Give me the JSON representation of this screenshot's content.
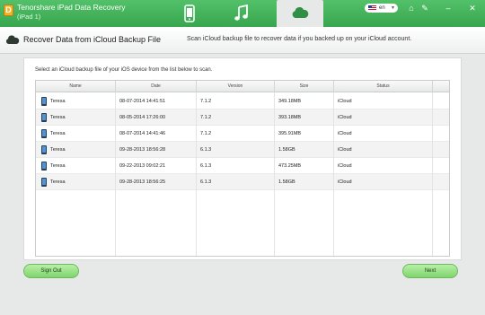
{
  "app": {
    "title": "Tenorshare iPad Data Recovery",
    "device": "(iPad 1)",
    "logo_letter": "D",
    "language": "en",
    "accent_color": "#3cad54"
  },
  "mode_tabs": [
    {
      "icon": "phone-icon",
      "active": false
    },
    {
      "icon": "music-note-icon",
      "active": false
    },
    {
      "icon": "cloud-icon",
      "active": true
    }
  ],
  "window_icons": [
    "home-icon",
    "settings-icon",
    "minimize-icon",
    "close-icon"
  ],
  "header": {
    "title": "Recover Data from iCloud Backup File",
    "description": "Scan iCloud backup file to recover data if you backed up on your iCloud account."
  },
  "instruction": "Select an iCloud backup file of your iOS device from the list below to scan.",
  "table": {
    "columns": [
      "Name",
      "Date",
      "Version",
      "Size",
      "Status"
    ],
    "rows": [
      {
        "name": "Teresa",
        "date": "08-07-2014 14:41:51",
        "version": "7.1.2",
        "size": "349.18MB",
        "status": "iCloud"
      },
      {
        "name": "Teresa",
        "date": "08-05-2014 17:26:00",
        "version": "7.1.2",
        "size": "393.18MB",
        "status": "iCloud"
      },
      {
        "name": "Teresa",
        "date": "08-07-2014 14:41:46",
        "version": "7.1.2",
        "size": "395.91MB",
        "status": "iCloud"
      },
      {
        "name": "Teresa",
        "date": "09-28-2013 18:56:28",
        "version": "6.1.3",
        "size": "1.58GB",
        "status": "iCloud"
      },
      {
        "name": "Teresa",
        "date": "09-22-2013 09:02:21",
        "version": "6.1.3",
        "size": "473.25MB",
        "status": "iCloud"
      },
      {
        "name": "Teresa",
        "date": "09-28-2013 18:56:25",
        "version": "6.1.3",
        "size": "1.58GB",
        "status": "iCloud"
      }
    ]
  },
  "buttons": {
    "sign_out": "Sign Out",
    "next": "Next"
  }
}
